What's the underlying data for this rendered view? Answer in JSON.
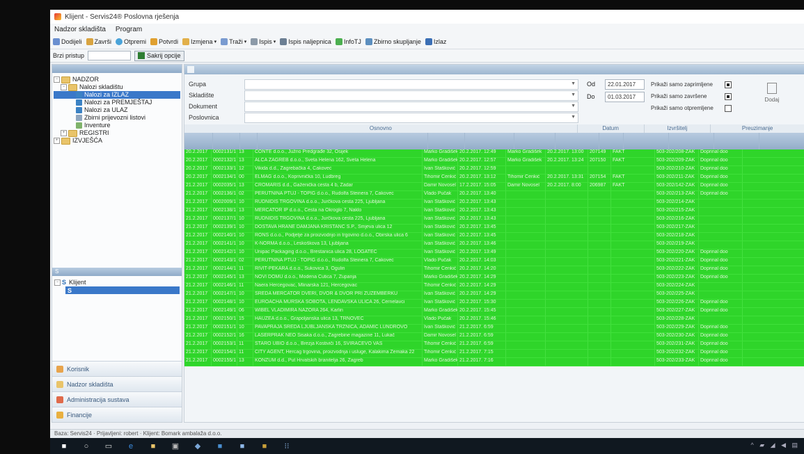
{
  "window": {
    "title": "Klijent - Servis24® Poslovna rješenja"
  },
  "menu": [
    "Nadzor skladišta",
    "Program"
  ],
  "toolbar": [
    {
      "label": "Dodijeli",
      "icon": "assign-icon",
      "color": "#6a8fd0",
      "dd": ""
    },
    {
      "label": "Završi",
      "icon": "finish-icon",
      "color": "#d9a441",
      "dd": ""
    },
    {
      "label": "Otpremi",
      "icon": "dispatch-icon",
      "color": "#4aa3d9",
      "dd": ""
    },
    {
      "label": "Potvrdi",
      "icon": "confirm-icon",
      "color": "#e0a030",
      "dd": ""
    },
    {
      "label": "Izmjena",
      "icon": "edit-icon",
      "color": "#e2b04a",
      "dd": "▾"
    },
    {
      "label": "Traži",
      "icon": "search-icon",
      "color": "#7a9bd0",
      "dd": "▾"
    },
    {
      "label": "Ispis",
      "icon": "print-icon",
      "color": "#8c9aa8",
      "dd": "▾"
    },
    {
      "label": "Ispis naljepnica",
      "icon": "label-print-icon",
      "color": "#6c7f93",
      "dd": ""
    },
    {
      "label": "InfoTJ",
      "icon": "info-icon",
      "color": "#4caf50",
      "dd": ""
    },
    {
      "label": "Zbirno skupljanje",
      "icon": "collect-icon",
      "color": "#5c8fbf",
      "dd": ""
    },
    {
      "label": "Izlaz",
      "icon": "exit-icon",
      "color": "#3b6fb5",
      "dd": ""
    }
  ],
  "quick": {
    "label": "Brzi pristup",
    "button": "Sakrij opcije"
  },
  "tree": {
    "root": "NADZOR",
    "group": "Nalozi skladištu",
    "items": [
      "Nalozi za IZLAZ",
      "Nalozi za PREMJEŠTAJ",
      "Nalozi za ULAZ",
      "Zbirni prijevozni listovi",
      "Inventure"
    ],
    "registri": "REGISTRI",
    "izvjesca": "IZVJEŠĆA"
  },
  "klijent": {
    "header": "S",
    "item": "Klijent"
  },
  "nav": [
    "Korisnik",
    "Nadzor skladišta",
    "Administracija sustava",
    "Financije"
  ],
  "filters": {
    "grupa": "Grupa",
    "skladiste": "Skladište",
    "dokument": "Dokument",
    "poslovnica": "Poslovnica"
  },
  "dates": {
    "od_label": "Od",
    "od": "22.01.2017",
    "do_label": "Do",
    "do": "01.03.2017"
  },
  "checks": [
    {
      "label": "Prikaži samo zaprimljene",
      "on": true
    },
    {
      "label": "Prikaži samo završene",
      "on": true
    },
    {
      "label": "Prikaži samo otpremljene",
      "on": false
    }
  ],
  "side_button": "Dodaj",
  "groups": [
    "Osnovno",
    "Datum",
    "Izvršitelj",
    "Preuzimanje"
  ],
  "rows": [
    {
      "date": "20.2.2017",
      "num": "0002131/1",
      "c": "13",
      "partner": "CONTE d.o.o., Južno Predgrađe 32, Osijek",
      "user": "Marko Gradišek",
      "created": "20.2.2017. 12:49",
      "exec": "Marko Gradišek",
      "done": "20.2.2017. 13:00",
      "id": "207149",
      "st": "FAKT",
      "doc": "503-202/208-ZAK",
      "end": "Doprinal doo"
    },
    {
      "date": "20.2.2017",
      "num": "0002132/1",
      "c": "13",
      "partner": "ALCA ZAGREB d.o.o., Sveta Helena 162, Sveta Helena",
      "user": "Marko Gradišek",
      "created": "20.2.2017. 12:57",
      "exec": "Marko Gradišek",
      "done": "20.2.2017. 13:24",
      "id": "207150",
      "st": "FAKT",
      "doc": "503-202/209-ZAK",
      "end": "Doprinal doo"
    },
    {
      "date": "20.2.2017",
      "num": "0002133/1",
      "c": "12",
      "partner": "Vikida d.d., Zagrebačka 4, Čakovec",
      "user": "Ivan Stašković",
      "created": "20.2.2017. 12:59",
      "exec": "",
      "done": "",
      "id": "",
      "st": "",
      "doc": "503-202/210-ZAK",
      "end": "Doprinal doo"
    },
    {
      "date": "20.2.2017",
      "num": "0002134/1",
      "c": "00",
      "partner": "ELMAG d.o.o., Koprivnička 10, Ludbreg",
      "user": "Tihomir Cenkić",
      "created": "20.2.2017. 13:12",
      "exec": "Tihomir Cenkić",
      "done": "20.2.2017. 13:31",
      "id": "207154",
      "st": "FAKT",
      "doc": "503-202/211-ZAK",
      "end": "Doprinal doo"
    },
    {
      "date": "21.2.2017",
      "num": "0002035/1",
      "c": "13",
      "partner": "CROMARIS d.d., Gaženička cesta 4 b, Zadar",
      "user": "Damir Novosel",
      "created": "17.2.2017. 15:05",
      "exec": "Damir Novosel",
      "done": "20.2.2017. 8:00",
      "id": "206987",
      "st": "FAKT",
      "doc": "503-202/142-ZAK",
      "end": "Doprinal doo"
    },
    {
      "date": "21.2.2017",
      "num": "0002136/1",
      "c": "02",
      "partner": "PERUTNINA PTUJ - TOPIG d.o.o., Rudolfa Steinera 7, Čakovec",
      "user": "Vlado Pučak",
      "created": "20.2.2017. 13:40",
      "exec": "",
      "done": "",
      "id": "",
      "st": "",
      "doc": "503-202/213-ZAK",
      "end": "Doprinal doo"
    },
    {
      "date": "21.2.2017",
      "num": "0002009/1",
      "c": "10",
      "partner": "RUDNIDIS TRGOVINA d.o.o., Jurčkova cesta 225, Ljubljana",
      "user": "Ivan Stašković",
      "created": "20.2.2017. 13:43",
      "exec": "",
      "done": "",
      "id": "",
      "st": "",
      "doc": "503-202/214-ZAK",
      "end": ""
    },
    {
      "date": "21.2.2017",
      "num": "0002138/1",
      "c": "13",
      "partner": "MERCATOR IP d.o.o., Cesta na Okroglo 7, Naklo",
      "user": "Ivan Stašković",
      "created": "20.2.2017. 13:43",
      "exec": "",
      "done": "",
      "id": "",
      "st": "",
      "doc": "503-202/215-ZAK",
      "end": ""
    },
    {
      "date": "21.2.2017",
      "num": "0002137/1",
      "c": "10",
      "partner": "RUDNIDIS TRGOVINA d.o.o., Jurčkova cesta 225, Ljubljana",
      "user": "Ivan Stašković",
      "created": "20.2.2017. 13:43",
      "exec": "",
      "done": "",
      "id": "",
      "st": "",
      "doc": "503-202/216-ZAK",
      "end": ""
    },
    {
      "date": "21.2.2017",
      "num": "0002139/1",
      "c": "10",
      "partner": "DOSTAVA HRANE DAMJANA KRISTANC S.P., Šmjeva ulica 12",
      "user": "Ivan Stašković",
      "created": "20.2.2017. 13:45",
      "exec": "",
      "done": "",
      "id": "",
      "st": "",
      "doc": "503-202/217-ZAK",
      "end": ""
    },
    {
      "date": "21.2.2017",
      "num": "0002140/1",
      "c": "10",
      "partner": "RONS d.o.o., Podjetje za proizvodnjo in trgovino d.o.o., Obirska ulica 6",
      "user": "Ivan Stašković",
      "created": "20.2.2017. 13:45",
      "exec": "",
      "done": "",
      "id": "",
      "st": "",
      "doc": "503-202/218-ZAK",
      "end": ""
    },
    {
      "date": "21.2.2017",
      "num": "0002141/1",
      "c": "10",
      "partner": "K-NORMA d.o.o., Leskoškova 13, Ljubljana",
      "user": "Ivan Stašković",
      "created": "20.2.2017. 13:46",
      "exec": "",
      "done": "",
      "id": "",
      "st": "",
      "doc": "503-202/219-ZAK",
      "end": ""
    },
    {
      "date": "21.2.2017",
      "num": "0002142/1",
      "c": "10",
      "partner": "Unipac Packaging d.o.o., Brestanica ulica 28, LOGATEC",
      "user": "Ivan Stašković",
      "created": "20.2.2017. 13:49",
      "exec": "",
      "done": "",
      "id": "",
      "st": "",
      "doc": "503-202/220-ZAK",
      "end": "Doprinal doo"
    },
    {
      "date": "21.2.2017",
      "num": "0002143/1",
      "c": "02",
      "partner": "PERUTNINA PTUJ - TOPIG d.o.o., Rudolfa Steinera 7, Čakovec",
      "user": "Vlado Pučak",
      "created": "20.2.2017. 14:03",
      "exec": "",
      "done": "",
      "id": "",
      "st": "",
      "doc": "503-202/221-ZAK",
      "end": "Doprinal doo"
    },
    {
      "date": "21.2.2017",
      "num": "0002144/1",
      "c": "11",
      "partner": "RIVIT-PEKARA d.o.o., Sukovica 3, Ogulin",
      "user": "Tihomir Cenkić",
      "created": "20.2.2017. 14:20",
      "exec": "",
      "done": "",
      "id": "",
      "st": "",
      "doc": "503-202/222-ZAK",
      "end": "Doprinal doo"
    },
    {
      "date": "21.2.2017",
      "num": "0002145/1",
      "c": "13",
      "partner": "NOVI DOMU d.o.o., Modena Cutica 7, Županja",
      "user": "Marko Gradišek",
      "created": "20.2.2017. 14:29",
      "exec": "",
      "done": "",
      "id": "",
      "st": "",
      "doc": "503-202/223-ZAK",
      "end": "Doprinal doo"
    },
    {
      "date": "21.2.2017",
      "num": "0002146/1",
      "c": "11",
      "partner": "Naera Hercegovac, Mlinarska 121, Hercegovac",
      "user": "Tihomir Cenkić",
      "created": "20.2.2017. 14:29",
      "exec": "",
      "done": "",
      "id": "",
      "st": "",
      "doc": "503-202/224-ZAK",
      "end": ""
    },
    {
      "date": "21.2.2017",
      "num": "0002147/1",
      "c": "10",
      "partner": "SREDA MERCATOR DVERI, DVOR & DVOR PRI ŽUŽEMBERKU",
      "user": "Ivan Stašković",
      "created": "20.2.2017. 14:29",
      "exec": "",
      "done": "",
      "id": "",
      "st": "",
      "doc": "503-202/225-ZAK",
      "end": ""
    },
    {
      "date": "21.2.2017",
      "num": "0002148/1",
      "c": "10",
      "partner": "EUROACHA MURSKA SOBOTA, LENDAVSKA ULICA 26, Černelavci",
      "user": "Ivan Stašković",
      "created": "20.2.2017. 15:30",
      "exec": "",
      "done": "",
      "id": "",
      "st": "",
      "doc": "503-202/226-ZAK",
      "end": "Doprinal doo"
    },
    {
      "date": "21.2.2017",
      "num": "0002149/1",
      "c": "06",
      "partner": "WIBEL VLADIMIRA NAZORA 264, Karlin",
      "user": "Marko Gradišek",
      "created": "20.2.2017. 15:45",
      "exec": "",
      "done": "",
      "id": "",
      "st": "",
      "doc": "503-202/227-ZAK",
      "end": "Doprinal doo"
    },
    {
      "date": "21.2.2017",
      "num": "0002150/1",
      "c": "15",
      "partner": "HAUZEA d.o.o., Grapoljanska ulica 13, TRNOVEC",
      "user": "Vlado Pučak",
      "created": "20.2.2017. 15:46",
      "exec": "",
      "done": "",
      "id": "",
      "st": "",
      "doc": "503-202/228-ZAK",
      "end": ""
    },
    {
      "date": "21.2.2017",
      "num": "0002151/1",
      "c": "10",
      "partner": "PAVAPRAJA SREDA LJUBLJANSKA TRŽNICA, ADAMIČ LUNDROVO",
      "user": "Ivan Stašković",
      "created": "21.2.2017. 6:59",
      "exec": "",
      "done": "",
      "id": "",
      "st": "",
      "doc": "503-202/229-ZAK",
      "end": "Doprinal doo"
    },
    {
      "date": "21.2.2017",
      "num": "0002152/1",
      "c": "16",
      "partner": "LASERPRAK NEO Sisaka d.o.o., Zagrebine magazine 11, Lukač",
      "user": "Damir Novosel",
      "created": "21.2.2017. 6:59",
      "exec": "",
      "done": "",
      "id": "",
      "st": "",
      "doc": "503-202/230-ZAK",
      "end": "Doprinal doo"
    },
    {
      "date": "21.2.2017",
      "num": "0002153/1",
      "c": "11",
      "partner": "STARO UBIO d.o.o., Brezja Kostiviči 16, SVIRAČEVO VAS",
      "user": "Tihomir Cenkić",
      "created": "21.2.2017. 6:59",
      "exec": "",
      "done": "",
      "id": "",
      "st": "",
      "doc": "503-202/231-ZAK",
      "end": "Doprinal doo"
    },
    {
      "date": "21.2.2017",
      "num": "0002154/1",
      "c": "11",
      "partner": "CITY AGENT, Hercag trgovina, proizvodnja i usluge, Kalakima Zemaka 22",
      "user": "Tihomir Cenkić",
      "created": "21.2.2017. 7:15",
      "exec": "",
      "done": "",
      "id": "",
      "st": "",
      "doc": "503-202/232-ZAK",
      "end": "Doprinal doo"
    },
    {
      "date": "21.2.2017",
      "num": "0002155/1",
      "c": "13",
      "partner": "KONZUM d.d., Put Hrvatskih branitelja 26, Zagreb",
      "user": "Marko Gradišek",
      "created": "21.2.2017. 7:16",
      "exec": "",
      "done": "",
      "id": "",
      "st": "",
      "doc": "503-202/233-ZAK",
      "end": "Doprinal doo"
    }
  ],
  "status": "Baza: Servis24 · Prijavljeni: robert · Klijent: Bomark ambalaža d.o.o."
}
